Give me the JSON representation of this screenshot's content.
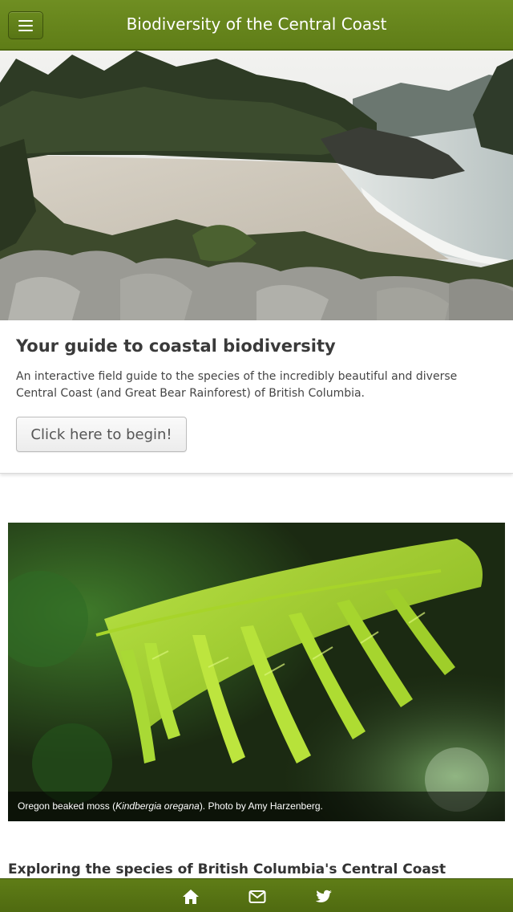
{
  "header": {
    "title": "Biodiversity of the Central Coast",
    "menu_icon": "hamburger-menu-icon"
  },
  "intro": {
    "heading": "Your guide to coastal biodiversity",
    "description": "An interactive field guide to the species of the incredibly beautiful and diverse Central Coast (and Great Bear Rainforest) of British Columbia.",
    "button_label": "Click here to begin!"
  },
  "photo": {
    "caption_prefix": "Oregon beaked moss (",
    "caption_species": "Kindbergia oregana",
    "caption_suffix": "). Photo by Amy Harzenberg."
  },
  "section": {
    "heading": "Exploring the species of British Columbia's Central Coast"
  },
  "footer": {
    "icons": [
      "home-icon",
      "envelope-icon",
      "twitter-icon"
    ]
  },
  "colors": {
    "brand_green": "#617f18",
    "bar_border": "#4d6810"
  }
}
